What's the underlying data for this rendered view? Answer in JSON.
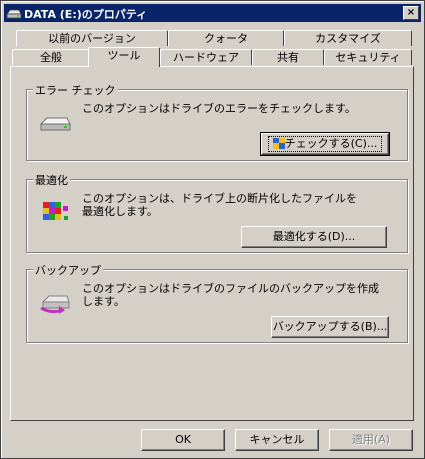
{
  "window": {
    "title": "DATA (E:)のプロパティ",
    "close_glyph": "×"
  },
  "tabs_back": [
    {
      "label": "以前のバージョン"
    },
    {
      "label": "クォータ"
    },
    {
      "label": "カスタマイズ"
    }
  ],
  "tabs_front": [
    {
      "label": "全般"
    },
    {
      "label": "ツール"
    },
    {
      "label": "ハードウェア"
    },
    {
      "label": "共有"
    },
    {
      "label": "セキュリティ"
    }
  ],
  "active_tab": "ツール",
  "groups": {
    "error_check": {
      "title": "エラー チェック",
      "desc": "このオプションはドライブのエラーをチェックします。",
      "button": "チェックする(C)..."
    },
    "defrag": {
      "title": "最適化",
      "desc": "このオプションは、ドライブ上の断片化したファイルを最適化します。",
      "button": "最適化する(D)..."
    },
    "backup": {
      "title": "バックアップ",
      "desc": "このオプションはドライブのファイルのバックアップを作成します。",
      "button": "バックアップする(B)..."
    }
  },
  "footer": {
    "ok": "OK",
    "cancel": "キャンセル",
    "apply": "適用(A)"
  }
}
